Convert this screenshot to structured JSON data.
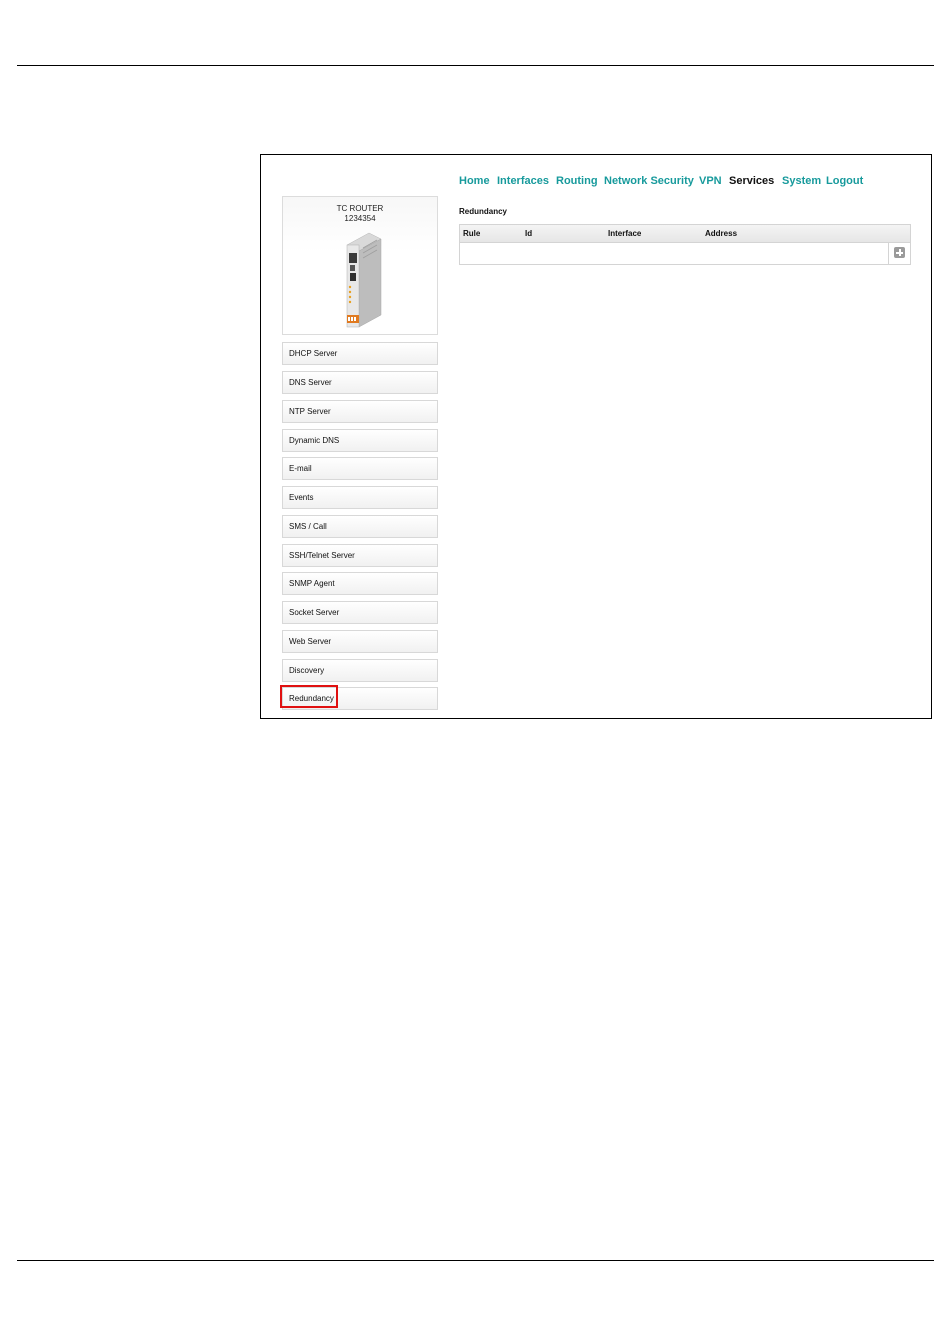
{
  "device": {
    "name": "TC ROUTER",
    "serial": "1234354"
  },
  "nav": [
    {
      "label": "Home",
      "active": false
    },
    {
      "label": "Interfaces",
      "active": false
    },
    {
      "label": "Routing",
      "active": false
    },
    {
      "label": "Network Security",
      "active": false
    },
    {
      "label": "VPN",
      "active": false
    },
    {
      "label": "Services",
      "active": true
    },
    {
      "label": "System",
      "active": false
    },
    {
      "label": "Logout",
      "active": false
    }
  ],
  "sidebar": {
    "items": [
      {
        "label": "DHCP Server"
      },
      {
        "label": "DNS Server"
      },
      {
        "label": "NTP Server"
      },
      {
        "label": "Dynamic DNS"
      },
      {
        "label": "E-mail"
      },
      {
        "label": "Events"
      },
      {
        "label": "SMS / Call"
      },
      {
        "label": "SSH/Telnet Server"
      },
      {
        "label": "SNMP Agent"
      },
      {
        "label": "Socket Server"
      },
      {
        "label": "Web Server"
      },
      {
        "label": "Discovery"
      },
      {
        "label": "Redundancy",
        "highlighted": true
      }
    ]
  },
  "main": {
    "title": "Redundancy",
    "table": {
      "columns": [
        "Rule",
        "Id",
        "Interface",
        "Address"
      ],
      "rows": []
    }
  },
  "colors": {
    "nav_link": "#179a9c",
    "highlight_border": "#e01010"
  },
  "icons": {
    "add": "plus-square-icon"
  }
}
